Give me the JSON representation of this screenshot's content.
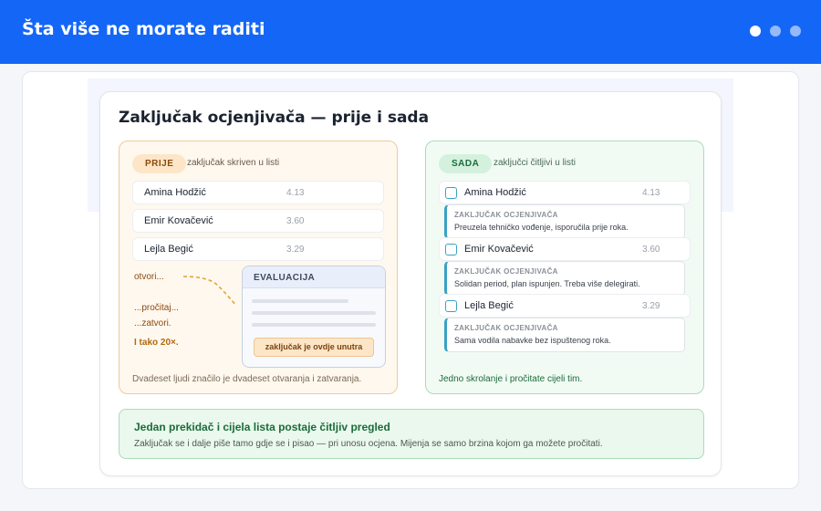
{
  "header": {
    "title": "Šta više ne morate raditi",
    "dots": 3,
    "active_dot": 1
  },
  "card": {
    "title": "Zaključak ocjenjivača — prije i sada"
  },
  "before": {
    "badge": "PRIJE",
    "caption": "zaključak skriven u listi",
    "rows": [
      {
        "name": "Amina Hodžić",
        "score": "4.13"
      },
      {
        "name": "Emir Kovačević",
        "score": "3.60"
      },
      {
        "name": "Lejla Begić",
        "score": "3.29"
      }
    ],
    "steps": [
      "otvori...",
      "...pročitaj...",
      "...zatvori.",
      "I tako 20×."
    ],
    "modal": {
      "title": "EVALUACIJA",
      "chip": "zaključak je ovdje unutra"
    },
    "footer": "Dvadeset ljudi značilo je dvadeset otvaranja i zatvaranja."
  },
  "after": {
    "badge": "SADA",
    "caption": "zaključci čitljivi u listi",
    "rows": [
      {
        "name": "Amina Hodžić",
        "score": "4.13",
        "note_label": "ZAKLJUČAK OCJENJIVAČA",
        "note": "Preuzela tehničko vođenje, isporučila prije roka."
      },
      {
        "name": "Emir Kovačević",
        "score": "3.60",
        "note_label": "ZAKLJUČAK OCJENJIVAČA",
        "note": "Solidan period, plan ispunjen. Treba više delegirati."
      },
      {
        "name": "Lejla Begić",
        "score": "3.29",
        "note_label": "ZAKLJUČAK OCJENJIVAČA",
        "note": "Sama vodila nabavke bez ispuštenog roka."
      }
    ],
    "footer": "Jedno skrolanje i pročitate cijeli tim."
  },
  "banner": {
    "title": "Jedan prekidač i cijela lista postaje čitljiv pregled",
    "text": "Zaključak se i dalje piše tamo gdje se i pisao — pri unosu ocjena. Mijenja se samo brzina kojom ga možete pročitati."
  },
  "colors": {
    "header_blue": "#1467f6",
    "before_accent": "#f2c996",
    "after_accent": "#a9dcbb",
    "note_accent": "#3aa2c4"
  }
}
